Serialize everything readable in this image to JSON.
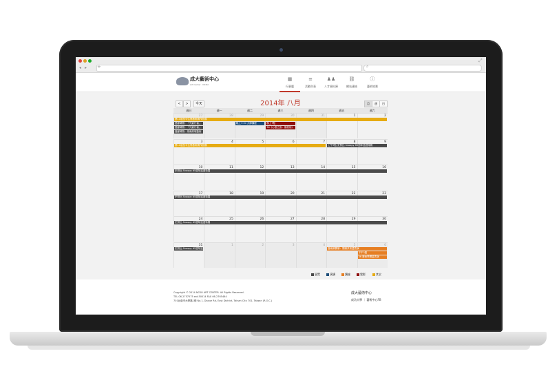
{
  "browser": {
    "nav_back": "◂",
    "nav_fwd": "▸",
    "url_plus": "+",
    "search_icon": "⌕",
    "corner": "⤢"
  },
  "site": {
    "logo_title": "成大藝術中心",
    "logo_sub": "Art Center · NCKU",
    "nav": [
      {
        "icon": "calendar-icon",
        "glyph": "▦",
        "label": "行事曆"
      },
      {
        "icon": "list-icon",
        "glyph": "≡",
        "label": "活動列表"
      },
      {
        "icon": "people-icon",
        "glyph": "♟♟",
        "label": "人才資料庫"
      },
      {
        "icon": "link-icon",
        "glyph": "⛓",
        "label": "網站連結"
      },
      {
        "icon": "info-icon",
        "glyph": "ⓘ",
        "label": "藝術地景"
      }
    ]
  },
  "calendar": {
    "title": "2014年 八月",
    "prev": "<",
    "next": ">",
    "today": "今天",
    "views": [
      "月",
      "週",
      "日"
    ],
    "weekdays": [
      "週日",
      "週一",
      "週二",
      "週三",
      "週四",
      "週五",
      "週六"
    ],
    "weeks": [
      {
        "days": [
          {
            "n": "27",
            "o": true
          },
          {
            "n": "28",
            "o": true
          },
          {
            "n": "29",
            "o": true
          },
          {
            "n": "30",
            "o": true
          },
          {
            "n": "31",
            "o": true
          },
          {
            "n": "1",
            "o": false
          },
          {
            "n": "2",
            "o": false
          }
        ]
      },
      {
        "days": [
          {
            "n": "3",
            "o": false
          },
          {
            "n": "4",
            "o": false
          },
          {
            "n": "5",
            "o": false
          },
          {
            "n": "6",
            "o": false
          },
          {
            "n": "7",
            "o": false
          },
          {
            "n": "8",
            "o": false
          },
          {
            "n": "9",
            "o": false
          }
        ]
      },
      {
        "days": [
          {
            "n": "10",
            "o": false
          },
          {
            "n": "11",
            "o": false
          },
          {
            "n": "12",
            "o": false
          },
          {
            "n": "13",
            "o": false
          },
          {
            "n": "14",
            "o": false
          },
          {
            "n": "15",
            "o": false
          },
          {
            "n": "16",
            "o": false
          }
        ]
      },
      {
        "days": [
          {
            "n": "17",
            "o": false
          },
          {
            "n": "18",
            "o": false
          },
          {
            "n": "19",
            "o": false
          },
          {
            "n": "20",
            "o": false
          },
          {
            "n": "21",
            "o": false
          },
          {
            "n": "22",
            "o": false
          },
          {
            "n": "23",
            "o": false
          }
        ]
      },
      {
        "days": [
          {
            "n": "24",
            "o": false
          },
          {
            "n": "25",
            "o": false
          },
          {
            "n": "26",
            "o": false
          },
          {
            "n": "27",
            "o": false
          },
          {
            "n": "28",
            "o": false
          },
          {
            "n": "29",
            "o": false
          },
          {
            "n": "30",
            "o": false
          }
        ]
      },
      {
        "days": [
          {
            "n": "31",
            "o": false
          },
          {
            "n": "1",
            "o": true
          },
          {
            "n": "2",
            "o": true
          },
          {
            "n": "3",
            "o": true
          },
          {
            "n": "4",
            "o": true
          },
          {
            "n": "5",
            "o": true
          },
          {
            "n": "6",
            "o": true
          }
        ]
      }
    ],
    "events": [
      {
        "week": 0,
        "start": 0,
        "span": 7,
        "row": 0,
        "color": "yellow",
        "text": "第11屆至今生態藝術展作品展"
      },
      {
        "week": 0,
        "start": 0,
        "span": 1,
        "row": 1,
        "color": "dark",
        "text": "藝廊導覽：「光影行者」"
      },
      {
        "week": 0,
        "start": 0,
        "span": 1,
        "row": 2,
        "color": "dark",
        "text": "藝廊導覽：「光影行者」"
      },
      {
        "week": 0,
        "start": 0,
        "span": 1,
        "row": 3,
        "color": "dark",
        "text": "藝廊導覽：臺南府城藝術"
      },
      {
        "week": 0,
        "start": 2,
        "span": 1,
        "row": 1,
        "color": "blue",
        "text": "晚上7:30 大師講座"
      },
      {
        "week": 0,
        "start": 3,
        "span": 1,
        "row": 1,
        "color": "red",
        "text": "晚上7點"
      },
      {
        "week": 0,
        "start": 3,
        "span": 1,
        "row": 2,
        "color": "red",
        "text": "36《心靈之旅：療癒系》"
      },
      {
        "week": 1,
        "start": 0,
        "span": 5,
        "row": 0,
        "color": "yellow",
        "text": "第11屆至今生態藝術展作品展"
      },
      {
        "week": 1,
        "start": 5,
        "span": 2,
        "row": 0,
        "color": "dark",
        "text": "上午9點 史努比 Snoopy 65週年巡迴特展"
      },
      {
        "week": 2,
        "start": 0,
        "span": 7,
        "row": 0,
        "color": "dark",
        "text": "史努比 Snoopy 65週年巡迴特展"
      },
      {
        "week": 3,
        "start": 0,
        "span": 7,
        "row": 0,
        "color": "dark",
        "text": "史努比 Snoopy 65週年巡迴特展"
      },
      {
        "week": 4,
        "start": 0,
        "span": 7,
        "row": 0,
        "color": "dark",
        "text": "史努比 Snoopy 65週年巡迴特展"
      },
      {
        "week": 5,
        "start": 0,
        "span": 1,
        "row": 0,
        "color": "dark",
        "text": "史努比 Snoopy 65週年巡迴特展"
      },
      {
        "week": 5,
        "start": 5,
        "span": 2,
        "row": 0,
        "color": "orange",
        "text": "藝術節開幕：開幕茶會暨表演"
      },
      {
        "week": 5,
        "start": 6,
        "span": 1,
        "row": 1,
        "color": "orange",
        "text": "下午3點"
      },
      {
        "week": 5,
        "start": 6,
        "span": 1,
        "row": 2,
        "color": "orange",
        "text": "36 藝術季開幕表演"
      }
    ],
    "legend": [
      {
        "label": "展覽",
        "color": "#4a4a4a"
      },
      {
        "label": "演講",
        "color": "#1d4e7a"
      },
      {
        "label": "講座",
        "color": "#e67e22"
      },
      {
        "label": "電影",
        "color": "#8e0f0f"
      },
      {
        "label": "其它",
        "color": "#e6ab12"
      }
    ]
  },
  "footer": {
    "line1": "Copyright © 2014 NCKU ART CENTER. All Rights Reserved.",
    "line2": "TEL 06-2757575 ext.50014 FAX 06-2765464",
    "line3": "701台南市大學路1號 No.1, Daxue Rd, East District, Tainan City 701, Taiwan (R.O.C.)",
    "logo": "成大藝術中心",
    "links": "成功大學 ｜ 藝術中心FB"
  }
}
